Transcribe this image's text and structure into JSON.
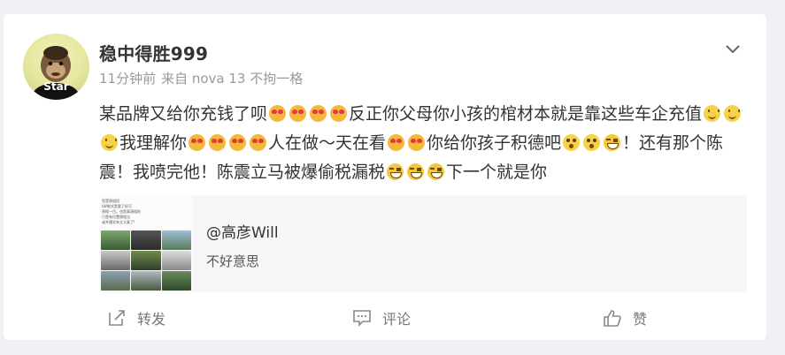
{
  "post": {
    "author": "稳中得胜999",
    "avatar_label": "Star",
    "time": "11分钟前",
    "source": "来自 nova 13 不拘一格",
    "text_segments": [
      {
        "t": "text",
        "v": "某品牌又给你充钱了呗"
      },
      {
        "t": "emoji",
        "v": "love"
      },
      {
        "t": "emoji",
        "v": "love"
      },
      {
        "t": "emoji",
        "v": "love"
      },
      {
        "t": "emoji",
        "v": "love"
      },
      {
        "t": "text",
        "v": "反正你父母你小孩的棺材本就是靠这些车企充值"
      },
      {
        "t": "emoji",
        "v": "smile"
      },
      {
        "t": "emoji",
        "v": "smile"
      },
      {
        "t": "emoji",
        "v": "smile"
      },
      {
        "t": "text",
        "v": "我理解你"
      },
      {
        "t": "emoji",
        "v": "love"
      },
      {
        "t": "emoji",
        "v": "love"
      },
      {
        "t": "emoji",
        "v": "love"
      },
      {
        "t": "emoji",
        "v": "love"
      },
      {
        "t": "text",
        "v": "人在做～天在看"
      },
      {
        "t": "emoji",
        "v": "love"
      },
      {
        "t": "emoji",
        "v": "love"
      },
      {
        "t": "text",
        "v": "你给你孩子积德吧"
      },
      {
        "t": "emoji",
        "v": "shock"
      },
      {
        "t": "emoji",
        "v": "shock"
      },
      {
        "t": "emoji",
        "v": "grin"
      },
      {
        "t": "text",
        "v": "！还有那个陈震！我喷完他！陈震立马被爆偷税漏税"
      },
      {
        "t": "emoji",
        "v": "grin"
      },
      {
        "t": "emoji",
        "v": "grin"
      },
      {
        "t": "emoji",
        "v": "grin"
      },
      {
        "t": "text",
        "v": "下一个就是你"
      }
    ]
  },
  "quote": {
    "author": "@高彦Will",
    "text": "不好意思",
    "thumb_lines": [
      "您受规相用",
      "LW制式是要了好可",
      "昂相一目。也是真演相的",
      "只是有位置想相当",
      "或并遭实有太大真了!"
    ]
  },
  "actions": {
    "repost": "转发",
    "comment": "评论",
    "like": "赞"
  },
  "icons": {
    "more": "chevron-down-icon",
    "repost": "repost-icon",
    "comment": "comment-icon",
    "like": "thumbs-up-icon"
  }
}
